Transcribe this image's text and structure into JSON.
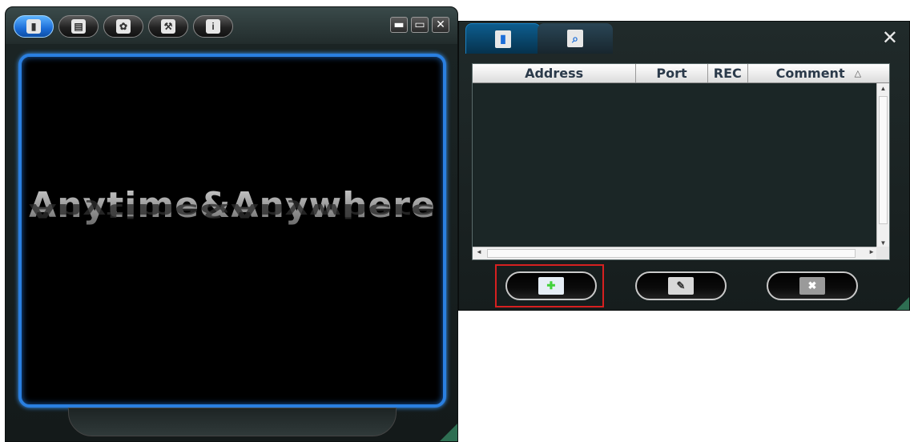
{
  "left_window": {
    "toolbar": [
      {
        "icon": "address-book-icon",
        "glyph": "▮",
        "active": true
      },
      {
        "icon": "documents-icon",
        "glyph": "▤",
        "active": false
      },
      {
        "icon": "settings-icon",
        "glyph": "✿",
        "active": false
      },
      {
        "icon": "tools-icon",
        "glyph": "⚒",
        "active": false
      },
      {
        "icon": "info-icon",
        "glyph": "i",
        "active": false
      }
    ],
    "controls": {
      "minimize": "▬",
      "maximize": "▭",
      "close": "✕"
    },
    "screen_text": "Anytime&Anywhere"
  },
  "right_window": {
    "tabs": [
      {
        "icon": "address-book-icon",
        "glyph": "▮",
        "active": true
      },
      {
        "icon": "search-icon",
        "glyph": "⌕",
        "active": false
      }
    ],
    "close": "✕",
    "table": {
      "columns": [
        "Address",
        "Port",
        "REC",
        "Comment"
      ],
      "sort_arrow": "△",
      "rows": []
    },
    "scroll": {
      "up": "▲",
      "down": "▼",
      "left": "◄",
      "right": "►"
    },
    "buttons": [
      {
        "name": "add-entry-button",
        "icon": "add-entry-icon",
        "glyph": "✚",
        "color": "#42d23a"
      },
      {
        "name": "edit-entry-button",
        "icon": "edit-entry-icon",
        "glyph": "✎",
        "color": "#e8e8e8"
      },
      {
        "name": "delete-entry-button",
        "icon": "delete-entry-icon",
        "glyph": "✖",
        "color": "#e8e8e8"
      }
    ]
  },
  "colors": {
    "accent_blue": "#2a7fe0",
    "highlight_red": "#d62020",
    "add_green": "#42d23a"
  }
}
